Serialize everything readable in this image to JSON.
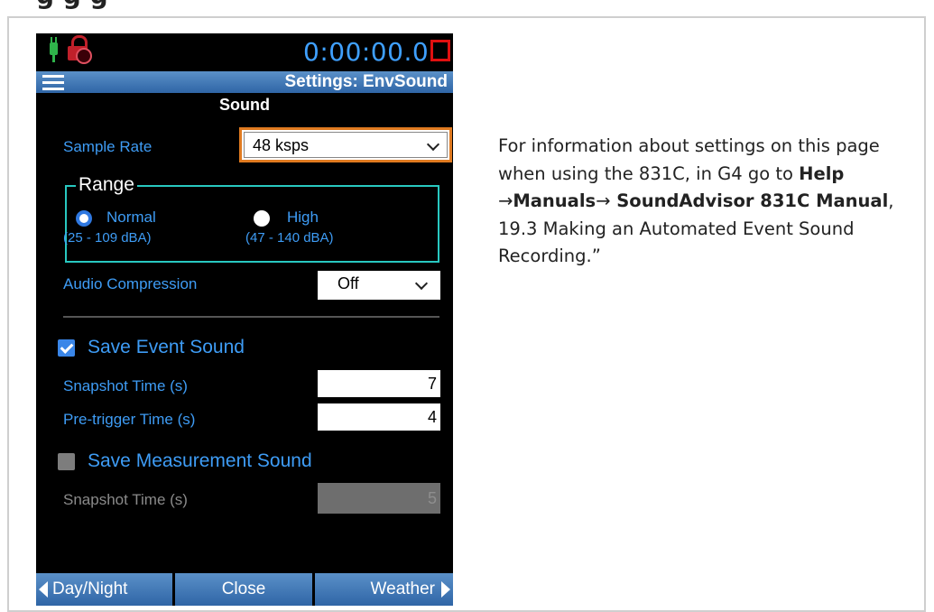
{
  "page": {
    "top_title": "g         g         g"
  },
  "status": {
    "timer": "0:00:00.0"
  },
  "header": {
    "title": "Settings: EnvSound"
  },
  "section": {
    "title": "Sound"
  },
  "sample_rate": {
    "label": "Sample Rate",
    "value": "48 ksps"
  },
  "range": {
    "legend": "Range",
    "normal_label": "Normal",
    "normal_sub": "(25 - 109 dBA)",
    "high_label": "High",
    "high_sub": "(47 - 140 dBA)",
    "selected": "Normal"
  },
  "audio_compression": {
    "label": "Audio Compression",
    "value": "Off"
  },
  "event_sound": {
    "label": "Save Event Sound",
    "checked": true,
    "snapshot_label": "Snapshot Time (s)",
    "snapshot_value": "7",
    "pretrigger_label": "Pre-trigger Time (s)",
    "pretrigger_value": "4"
  },
  "measurement_sound": {
    "label": "Save Measurement Sound",
    "checked": false,
    "snapshot_label": "Snapshot Time (s)",
    "snapshot_value": "5"
  },
  "footer": {
    "left": "Day/Night",
    "center": "Close",
    "right": "Weather"
  },
  "description": {
    "intro": "For information about settings on this page when using the 831C, in G4 go to",
    "help": "Help",
    "arrow": "→",
    "manuals": "Manuals",
    "soundadvisor": " SoundAdvisor 831C Manual",
    "rest": ", 19.3 Making an Automated Event Sound Recording.”"
  },
  "colors": {
    "accent_blue": "#3e9cf5",
    "header_blue": "#2f65a6",
    "range_border": "#28c8c0",
    "select_border": "#e07a20",
    "rec_red": "#e01010"
  }
}
